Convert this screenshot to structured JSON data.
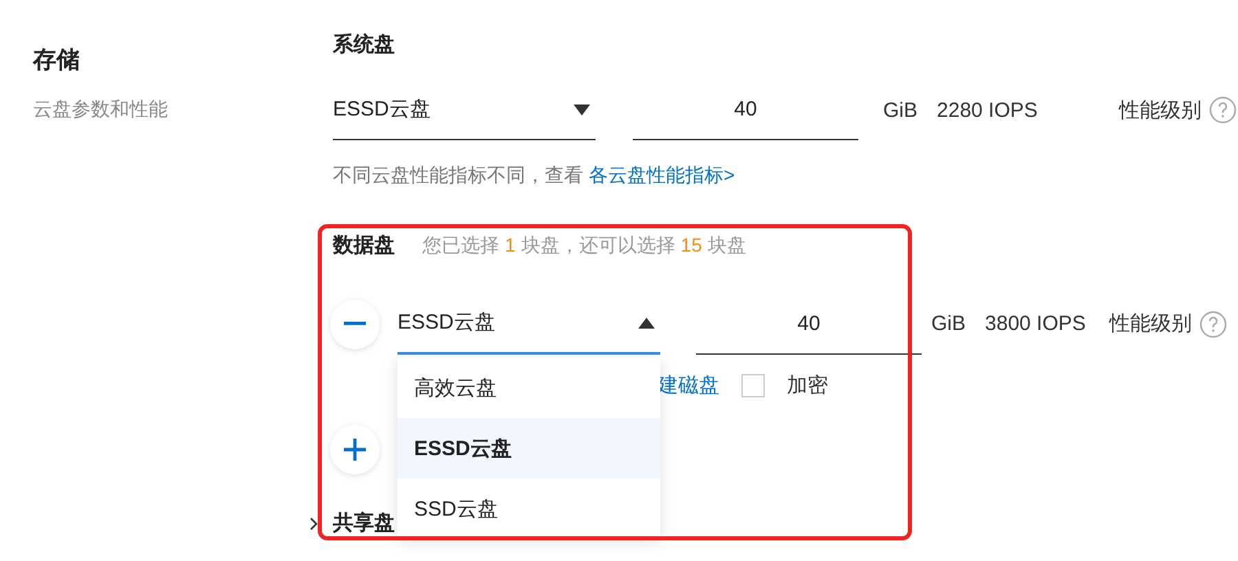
{
  "section": {
    "title": "存储",
    "subtitle": "云盘参数和性能"
  },
  "system_disk": {
    "label": "系统盘",
    "type_select": {
      "value": "ESSD云盘",
      "expanded": false
    },
    "size": "40",
    "unit": "GiB",
    "iops": "2280 IOPS",
    "performance_label": "性能级别",
    "hint": "不同云盘性能指标不同，查看",
    "hint_link": "各云盘性能指标>"
  },
  "data_disk": {
    "label": "数据盘",
    "note": {
      "prefix": "您已选择",
      "selected_count": "1",
      "middle": "块盘，还可以选择",
      "remaining_count": "15",
      "suffix": "块盘"
    },
    "disk": {
      "type_select": {
        "value": "ESSD云盘",
        "expanded": true
      },
      "size": "40",
      "unit": "GiB",
      "iops": "3800 IOPS",
      "performance_label": "性能级别",
      "link": "建磁盘",
      "encrypt": {
        "label": "加密",
        "checked": false
      }
    },
    "options": [
      {
        "label": "高效云盘",
        "selected": false
      },
      {
        "label": "ESSD云盘",
        "selected": true
      },
      {
        "label": "SSD云盘",
        "selected": false
      }
    ]
  },
  "shared_disk": {
    "label": "共享盘",
    "expanded": false
  }
}
